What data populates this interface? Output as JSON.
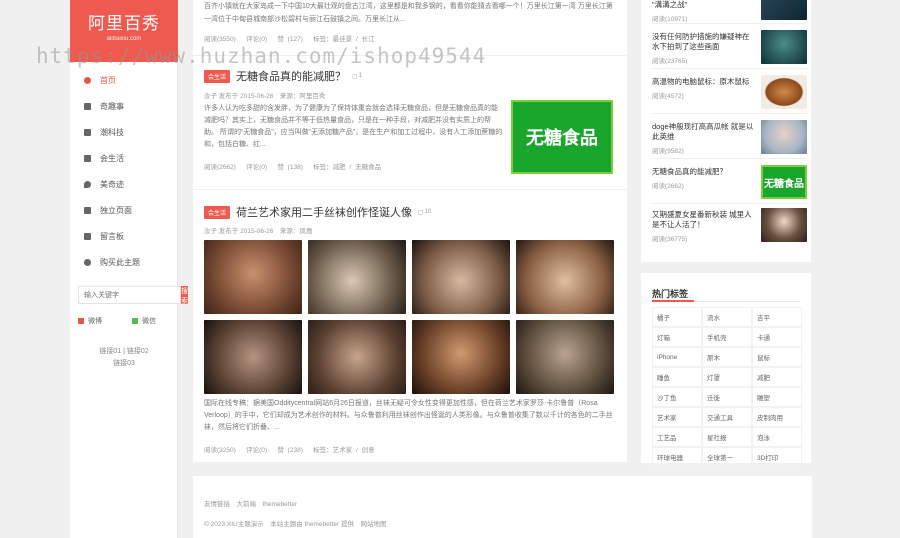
{
  "sidebar": {
    "logo_cn": "阿里百秀",
    "logo_en": "alibaixiu.com",
    "nav": [
      {
        "label": "首页",
        "icon": "home-icon",
        "active": true
      },
      {
        "label": "奇趣事",
        "icon": "star-icon"
      },
      {
        "label": "潮科技",
        "icon": "cube-icon"
      },
      {
        "label": "会生活",
        "icon": "cup-icon"
      },
      {
        "label": "美奇迹",
        "icon": "map-marker-icon"
      },
      {
        "label": "独立页面",
        "icon": "file-icon"
      },
      {
        "label": "留言板",
        "icon": "comment-icon"
      },
      {
        "label": "购买此主题",
        "icon": "cart-icon"
      }
    ],
    "search_placeholder": "输入关键字",
    "search_button": "搜索",
    "social": [
      "微博",
      "微信"
    ],
    "links_line1": "链接01 | 链接02",
    "links_line2": "链接03",
    "colors": {
      "accent": "#ee5a4f",
      "weibo": "#e4574a",
      "wechat": "#5cb85c"
    }
  },
  "main": {
    "top_excerpt": "百齐小镇就在大家岛成一下中国10大最壮观的盘古江湾，这里都是和我多钢的，看看你能猜去看哪一个！万里长江第一湾 万里长江第一湾位于中甸县城南部沙松碧村与丽江石鼓镇之间。万里长江从...",
    "top_stats": {
      "views": "阅读(3550)",
      "comments": "评论(0)",
      "likes": "赞 (127)",
      "tags": "标签：最佳景 / 长江"
    },
    "post1": {
      "tag": "会生活",
      "title": "无糖食品真的能减肥？",
      "comments": "1",
      "meta": "汝子 发布于 2015-06-26　来源：阿里百秀",
      "excerpt": "许多人认为吃多甜的含发胖，为了健康为了保持体重会就会选择无糖食品，但是无糖食品真的能减肥吗？其实上，无糖食品并不等于低热量食品，只是在一种手段，对减肥并没有实质上的帮助。 所谓的“无糖食品”，应当叫做“无添加糖产品”，是在生产和加工过程中，没有人工添加蔗糖的和，包括白糖、红...",
      "thumb_text": "无糖食品",
      "stats": {
        "views": "阅读(2662)",
        "comments": "评论(0)",
        "likes": "赞 (138)",
        "tags": "标签：减肥 / 无糖食品"
      }
    },
    "post2": {
      "tag": "会生活",
      "title": "荷兰艺术家用二手丝袜创作怪诞人像",
      "comments": "10",
      "meta": "汝子 发布于 2015-06-26　来源：凤凰",
      "excerpt": "国际在线专稿：据美国Odditycentral网站6月26日报道，丝袜无疑可令女性变得更加性感，但在荷兰艺术家罗莎·卡尔鲁普（Rosa Verloop）的手中，它们却成为艺术创作的材料。与众鲁普利用丝袜创作出怪诞的人类形像。与众鲁普收集了数以千计的各色的二手丝袜，然后将它们折叠、...",
      "stats": {
        "views": "阅读(3250)",
        "comments": "评论(0)",
        "likes": "赞 (238)",
        "tags": "标签：艺术家 / 创意"
      }
    }
  },
  "right": {
    "posts": [
      {
        "title": "\"溝溝之战\"",
        "views": "阅读(10971)"
      },
      {
        "title": "没有任何防护措施的嫌疑神在水下拍到了这些画面",
        "views": "阅读(23765)"
      },
      {
        "title": "高温物的电脑鼠标：原木鼠标",
        "views": "阅读(4572)"
      },
      {
        "title": "doge神般现打高高瓜帐 就是以此英维",
        "views": "阅读(9582)"
      },
      {
        "title": "无糖食品真的能减肥？",
        "views": "阅读(2662)"
      },
      {
        "title": "又期盛夏女星番新秋装 城里人是不让人活了！",
        "views": "阅读(36775)"
      }
    ],
    "hot_tags_title": "热门标签",
    "tags": [
      "橘子",
      "流水",
      "吉平",
      "灯箱",
      "手机壳",
      "卡通",
      "iPhone",
      "原木",
      "鼠标",
      "睡鱼",
      "灯罩",
      "减肥",
      "沙丁鱼",
      "迁徙",
      "雕塑",
      "艺术家",
      "交通工具",
      "皮制肉用",
      "工艺品",
      "星社报",
      "泡泳",
      "环球电器",
      "全球第一",
      "3D打印"
    ]
  },
  "footer": {
    "links": "友情链接　大前端　themebetter",
    "copyright": "© 2023 XIU主题演示　本站主题由 themebetter 提供　网站地图"
  },
  "watermark": "https://www.huzhan.com/ishop49544"
}
